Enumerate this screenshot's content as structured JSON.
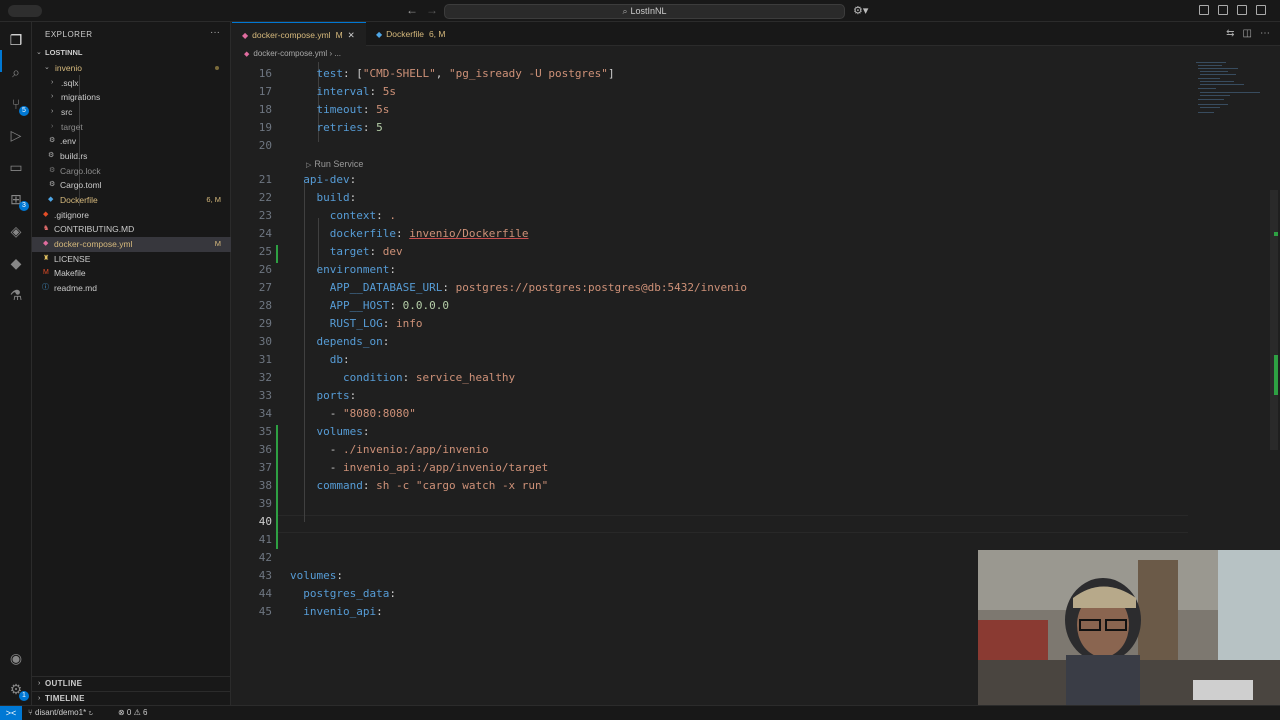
{
  "titlebar": {
    "search_text": "LostInNL",
    "search_icon": "search-icon"
  },
  "sidebar": {
    "header": "EXPLORER",
    "more_label": "···",
    "root": "LOSTINNL",
    "items": [
      {
        "label": "invenio",
        "color": "#d7ba7d"
      },
      {
        "label": ".sqlx",
        "color": "#cccccc"
      },
      {
        "label": "migrations",
        "color": "#cccccc"
      },
      {
        "label": "src",
        "color": "#cccccc"
      },
      {
        "label": "target",
        "color": "#8c8c8c"
      },
      {
        "label": ".env",
        "color": "#cccccc"
      },
      {
        "label": "build.rs",
        "color": "#cccccc"
      },
      {
        "label": "Cargo.lock",
        "color": "#8c8c8c"
      },
      {
        "label": "Cargo.toml",
        "color": "#cccccc"
      },
      {
        "label": "Dockerfile",
        "color": "#d7ba7d",
        "decoration": "6, M"
      },
      {
        "label": ".gitignore",
        "color": "#cccccc"
      },
      {
        "label": "CONTRIBUTING.MD",
        "color": "#cccccc"
      },
      {
        "label": "docker-compose.yml",
        "color": "#d7ba7d",
        "decoration": "M"
      },
      {
        "label": "LICENSE",
        "color": "#cccccc"
      },
      {
        "label": "Makefile",
        "color": "#cccccc"
      },
      {
        "label": "readme.md",
        "color": "#cccccc"
      }
    ],
    "outline": "OUTLINE",
    "timeline": "TIMELINE"
  },
  "tabs": [
    {
      "label": "docker-compose.yml",
      "status": "M",
      "active": true
    },
    {
      "label": "Dockerfile",
      "status": "6, M",
      "active": false
    }
  ],
  "breadcrumb": {
    "file": "docker-compose.yml",
    "sep": "›",
    "more": "..."
  },
  "editor": {
    "codelens": "Run Service",
    "current_line": "40",
    "lines": [
      {
        "n": "16"
      },
      {
        "n": "17"
      },
      {
        "n": "18"
      },
      {
        "n": "19"
      },
      {
        "n": "20"
      },
      {
        "n": "21"
      },
      {
        "n": "22"
      },
      {
        "n": "23"
      },
      {
        "n": "24"
      },
      {
        "n": "25"
      },
      {
        "n": "26"
      },
      {
        "n": "27"
      },
      {
        "n": "28"
      },
      {
        "n": "29"
      },
      {
        "n": "30"
      },
      {
        "n": "31"
      },
      {
        "n": "32"
      },
      {
        "n": "33"
      },
      {
        "n": "34"
      },
      {
        "n": "35"
      },
      {
        "n": "36"
      },
      {
        "n": "37"
      },
      {
        "n": "38"
      },
      {
        "n": "39"
      },
      {
        "n": "40"
      },
      {
        "n": "41"
      },
      {
        "n": "42"
      },
      {
        "n": "43"
      },
      {
        "n": "44"
      },
      {
        "n": "45"
      }
    ]
  },
  "status": {
    "remote_icon": "><",
    "branch": "disant/demo1*",
    "sync_icon": "↻",
    "problems": "⊗ 0 ⚠ 6"
  }
}
